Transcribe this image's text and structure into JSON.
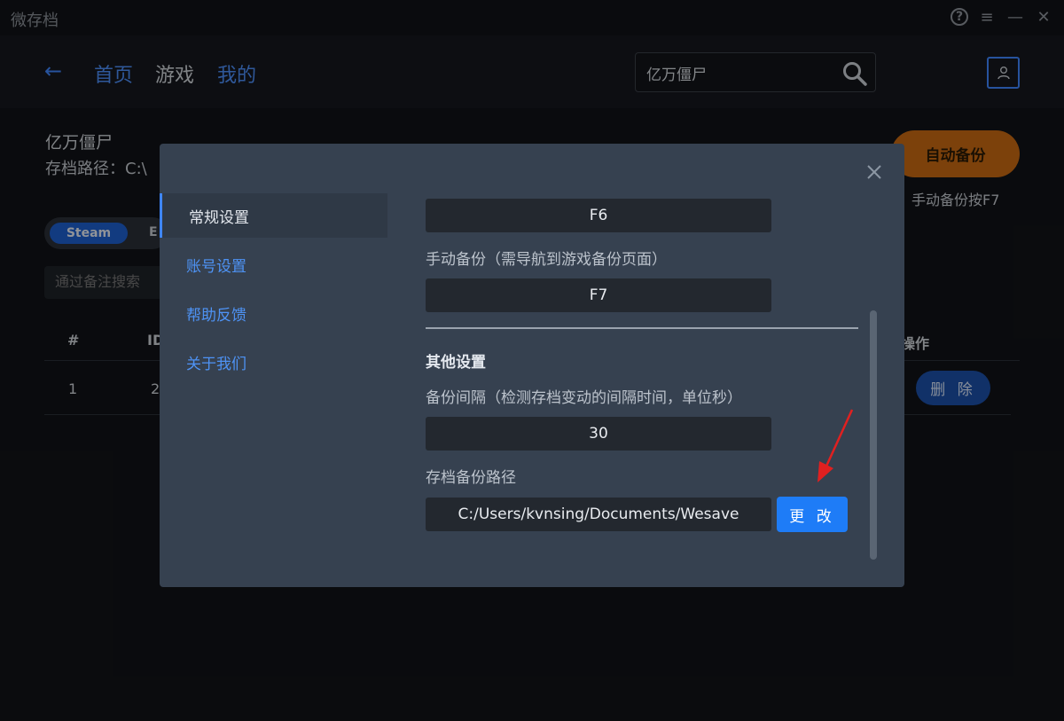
{
  "app": {
    "title": "微存档"
  },
  "window_controls": {
    "help": "?",
    "menu": "≡",
    "minimize": "—",
    "close": "✕"
  },
  "nav": {
    "back": "←",
    "links": [
      "首页",
      "游戏",
      "我的"
    ],
    "search_value": "亿万僵尸"
  },
  "game": {
    "name": "亿万僵尸",
    "path_label": "存档路径：C:\\",
    "auto_backup": "自动备份",
    "manual_hint": "手动备份按F7",
    "tabs": [
      "Steam",
      "E"
    ],
    "filter_placeholder": "通过备注搜索"
  },
  "table": {
    "headers": [
      "#",
      "ID",
      "操作"
    ],
    "row": [
      "1",
      "2"
    ],
    "delete": "删 除"
  },
  "modal": {
    "sidebar": [
      "常规设置",
      "账号设置",
      "帮助反馈",
      "关于我们"
    ],
    "hotkey_auto": "F6",
    "manual_label": "手动备份（需导航到游戏备份页面）",
    "hotkey_manual": "F7",
    "other_title": "其他设置",
    "interval_label": "备份间隔（检测存档变动的间隔时间，单位秒）",
    "interval_value": "30",
    "path_label": "存档备份路径",
    "path_value": "C:/Users/kvnsing/Documents/Wesave",
    "change": "更 改"
  },
  "colors": {
    "accent": "#1e7cf7",
    "auto_backup": "#c96a12",
    "modal_bg": "#364150",
    "arrow": "#e02020"
  }
}
